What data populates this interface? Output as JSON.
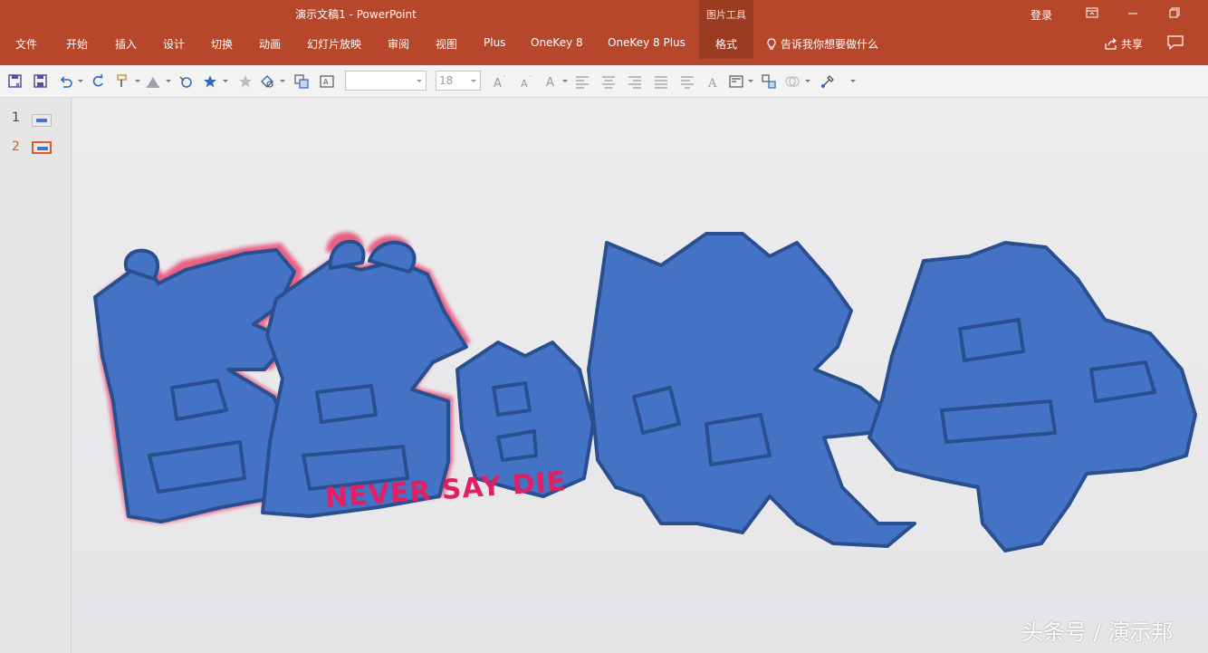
{
  "window": {
    "title": "演示文稿1  -  PowerPoint",
    "login_label": "登录"
  },
  "ribbon": {
    "tabs": [
      "文件",
      "开始",
      "插入",
      "设计",
      "切换",
      "动画",
      "幻灯片放映",
      "审阅",
      "视图",
      "Plus",
      "OneKey 8",
      "OneKey 8 Plus"
    ],
    "context_group_label": "图片工具",
    "context_tab_label": "格式",
    "tell_me": "告诉我你想要做什么",
    "share_label": "共享"
  },
  "toolbar": {
    "font_name_value": "",
    "font_size_value": "18"
  },
  "slides_pane": {
    "items": [
      {
        "number": "1",
        "active": false
      },
      {
        "number": "2",
        "active": true
      }
    ]
  },
  "slide": {
    "title_art": "羞羞的铁拳",
    "tagline": "NEVER SAY DIE",
    "fill_color": "#4472c4",
    "outline_color": "#2a4f8f",
    "accent_color": "#e11f63"
  },
  "watermark": "头条号 / 演示邦",
  "colors": {
    "ribbon_bg": "#b7472a",
    "context_tab_bg": "#9a3b22",
    "active_slide_border": "#e0582f"
  }
}
